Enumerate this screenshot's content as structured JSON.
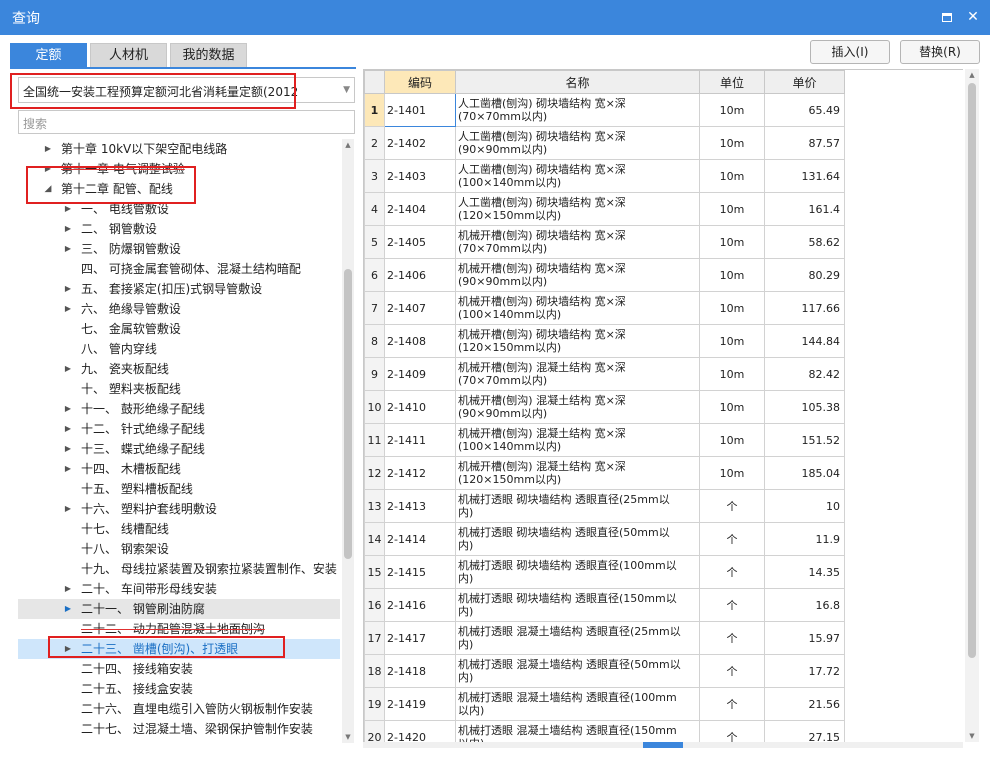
{
  "window": {
    "title": "查询",
    "maximize_icon": "maximize-icon",
    "close_label": "✕"
  },
  "tabs": [
    {
      "label": "定额",
      "active": true
    },
    {
      "label": "人材机",
      "active": false
    },
    {
      "label": "我的数据",
      "active": false
    }
  ],
  "actions": {
    "insert_label": "插入(I)",
    "replace_label": "替换(R)"
  },
  "left": {
    "library_select": "全国统一安装工程预算定额河北省消耗量定额(2012",
    "search_placeholder": "搜索"
  },
  "tree": [
    {
      "text": "第十章 10kV以下架空配电线路",
      "level": 0,
      "toggle": "collapsed",
      "strike": false,
      "highlight": ""
    },
    {
      "text": "第十一章 电气调整试验",
      "level": 0,
      "toggle": "collapsed",
      "strike": true,
      "highlight": ""
    },
    {
      "text": "第十二章 配管、配线",
      "level": 0,
      "toggle": "expanded",
      "strike": false,
      "highlight": ""
    },
    {
      "text": "一、 电线管敷设",
      "level": 1,
      "toggle": "collapsed",
      "strike": false,
      "highlight": ""
    },
    {
      "text": "二、 钢管敷设",
      "level": 1,
      "toggle": "collapsed",
      "strike": false,
      "highlight": ""
    },
    {
      "text": "三、 防爆钢管敷设",
      "level": 1,
      "toggle": "collapsed",
      "strike": false,
      "highlight": ""
    },
    {
      "text": "四、 可挠金属套管砌体、混凝土结构暗配",
      "level": 1,
      "toggle": "none",
      "strike": false,
      "highlight": ""
    },
    {
      "text": "五、 套接紧定(扣压)式钢导管敷设",
      "level": 1,
      "toggle": "collapsed",
      "strike": false,
      "highlight": ""
    },
    {
      "text": "六、 绝缘导管敷设",
      "level": 1,
      "toggle": "collapsed",
      "strike": false,
      "highlight": ""
    },
    {
      "text": "七、 金属软管敷设",
      "level": 1,
      "toggle": "none",
      "strike": false,
      "highlight": ""
    },
    {
      "text": "八、 管内穿线",
      "level": 1,
      "toggle": "none",
      "strike": false,
      "highlight": ""
    },
    {
      "text": "九、 瓷夹板配线",
      "level": 1,
      "toggle": "collapsed",
      "strike": false,
      "highlight": ""
    },
    {
      "text": "十、 塑料夹板配线",
      "level": 1,
      "toggle": "none",
      "strike": false,
      "highlight": ""
    },
    {
      "text": "十一、 鼓形绝缘子配线",
      "level": 1,
      "toggle": "collapsed",
      "strike": false,
      "highlight": ""
    },
    {
      "text": "十二、 针式绝缘子配线",
      "level": 1,
      "toggle": "collapsed",
      "strike": false,
      "highlight": ""
    },
    {
      "text": "十三、 蝶式绝缘子配线",
      "level": 1,
      "toggle": "collapsed",
      "strike": false,
      "highlight": ""
    },
    {
      "text": "十四、 木槽板配线",
      "level": 1,
      "toggle": "collapsed",
      "strike": false,
      "highlight": ""
    },
    {
      "text": "十五、 塑料槽板配线",
      "level": 1,
      "toggle": "none",
      "strike": false,
      "highlight": ""
    },
    {
      "text": "十六、 塑料护套线明敷设",
      "level": 1,
      "toggle": "collapsed",
      "strike": false,
      "highlight": ""
    },
    {
      "text": "十七、 线槽配线",
      "level": 1,
      "toggle": "none",
      "strike": false,
      "highlight": ""
    },
    {
      "text": "十八、 钢索架设",
      "level": 1,
      "toggle": "none",
      "strike": false,
      "highlight": ""
    },
    {
      "text": "十九、 母线拉紧装置及钢索拉紧装置制作、安装",
      "level": 1,
      "toggle": "none",
      "strike": false,
      "highlight": ""
    },
    {
      "text": "二十、 车间带形母线安装",
      "level": 1,
      "toggle": "collapsed",
      "strike": false,
      "highlight": ""
    },
    {
      "text": "二十一、 钢管刷油防腐",
      "level": 1,
      "toggle": "collapsed-blue",
      "strike": false,
      "highlight": "grey"
    },
    {
      "text": "二十二、 动力配管混凝土地面刨沟",
      "level": 1,
      "toggle": "none",
      "strike": true,
      "highlight": ""
    },
    {
      "text": "二十三、 凿槽(刨沟)、打透眼",
      "level": 1,
      "toggle": "collapsed",
      "strike": false,
      "highlight": "blue"
    },
    {
      "text": "二十四、 接线箱安装",
      "level": 1,
      "toggle": "none",
      "strike": false,
      "highlight": ""
    },
    {
      "text": "二十五、 接线盒安装",
      "level": 1,
      "toggle": "none",
      "strike": false,
      "highlight": ""
    },
    {
      "text": "二十六、 直埋电缆引入管防火钢板制作安装",
      "level": 1,
      "toggle": "none",
      "strike": false,
      "highlight": ""
    },
    {
      "text": "二十七、 过混凝土墙、梁钢保护管制作安装",
      "level": 1,
      "toggle": "none",
      "strike": false,
      "highlight": ""
    }
  ],
  "table": {
    "headers": {
      "code": "编码",
      "name": "名称",
      "unit": "单位",
      "price": "单价"
    },
    "rows": [
      {
        "no": "1",
        "code": "2-1401",
        "name1": "人工凿槽(刨沟) 砌块墙结构 宽×深",
        "name2": "(70×70mm以内)",
        "unit": "10m",
        "price": "65.49"
      },
      {
        "no": "2",
        "code": "2-1402",
        "name1": "人工凿槽(刨沟) 砌块墙结构 宽×深",
        "name2": "(90×90mm以内)",
        "unit": "10m",
        "price": "87.57"
      },
      {
        "no": "3",
        "code": "2-1403",
        "name1": "人工凿槽(刨沟) 砌块墙结构 宽×深",
        "name2": "(100×140mm以内)",
        "unit": "10m",
        "price": "131.64"
      },
      {
        "no": "4",
        "code": "2-1404",
        "name1": "人工凿槽(刨沟) 砌块墙结构 宽×深",
        "name2": "(120×150mm以内)",
        "unit": "10m",
        "price": "161.4"
      },
      {
        "no": "5",
        "code": "2-1405",
        "name1": "机械开槽(刨沟) 砌块墙结构 宽×深",
        "name2": "(70×70mm以内)",
        "unit": "10m",
        "price": "58.62"
      },
      {
        "no": "6",
        "code": "2-1406",
        "name1": "机械开槽(刨沟) 砌块墙结构 宽×深",
        "name2": "(90×90mm以内)",
        "unit": "10m",
        "price": "80.29"
      },
      {
        "no": "7",
        "code": "2-1407",
        "name1": "机械开槽(刨沟) 砌块墙结构 宽×深",
        "name2": "(100×140mm以内)",
        "unit": "10m",
        "price": "117.66"
      },
      {
        "no": "8",
        "code": "2-1408",
        "name1": "机械开槽(刨沟) 砌块墙结构 宽×深",
        "name2": "(120×150mm以内)",
        "unit": "10m",
        "price": "144.84"
      },
      {
        "no": "9",
        "code": "2-1409",
        "name1": "机械开槽(刨沟) 混凝土结构 宽×深",
        "name2": "(70×70mm以内)",
        "unit": "10m",
        "price": "82.42"
      },
      {
        "no": "10",
        "code": "2-1410",
        "name1": "机械开槽(刨沟) 混凝土结构 宽×深",
        "name2": "(90×90mm以内)",
        "unit": "10m",
        "price": "105.38"
      },
      {
        "no": "11",
        "code": "2-1411",
        "name1": "机械开槽(刨沟) 混凝土结构 宽×深",
        "name2": "(100×140mm以内)",
        "unit": "10m",
        "price": "151.52"
      },
      {
        "no": "12",
        "code": "2-1412",
        "name1": "机械开槽(刨沟) 混凝土结构 宽×深",
        "name2": "(120×150mm以内)",
        "unit": "10m",
        "price": "185.04"
      },
      {
        "no": "13",
        "code": "2-1413",
        "name1": "机械打透眼 砌块墙结构 透眼直径(25mm以",
        "name2": "内)",
        "unit": "个",
        "price": "10"
      },
      {
        "no": "14",
        "code": "2-1414",
        "name1": "机械打透眼 砌块墙结构 透眼直径(50mm以",
        "name2": "内)",
        "unit": "个",
        "price": "11.9"
      },
      {
        "no": "15",
        "code": "2-1415",
        "name1": "机械打透眼 砌块墙结构 透眼直径(100mm以",
        "name2": "内)",
        "unit": "个",
        "price": "14.35"
      },
      {
        "no": "16",
        "code": "2-1416",
        "name1": "机械打透眼 砌块墙结构 透眼直径(150mm以",
        "name2": "内)",
        "unit": "个",
        "price": "16.8"
      },
      {
        "no": "17",
        "code": "2-1417",
        "name1": "机械打透眼 混凝土墙结构 透眼直径(25mm以",
        "name2": "内)",
        "unit": "个",
        "price": "15.97"
      },
      {
        "no": "18",
        "code": "2-1418",
        "name1": "机械打透眼 混凝土墙结构 透眼直径(50mm以",
        "name2": "内)",
        "unit": "个",
        "price": "17.72"
      },
      {
        "no": "19",
        "code": "2-1419",
        "name1": "机械打透眼 混凝土墙结构 透眼直径(100mm",
        "name2": "以内)",
        "unit": "个",
        "price": "21.56"
      },
      {
        "no": "20",
        "code": "2-1420",
        "name1": "机械打透眼 混凝土墙结构 透眼直径(150mm",
        "name2": "以内)",
        "unit": "个",
        "price": "27.15"
      }
    ]
  },
  "colors": {
    "titlebar": "#3b86dc",
    "selected_header": "#fde8b8",
    "annotation": "#e02020"
  }
}
